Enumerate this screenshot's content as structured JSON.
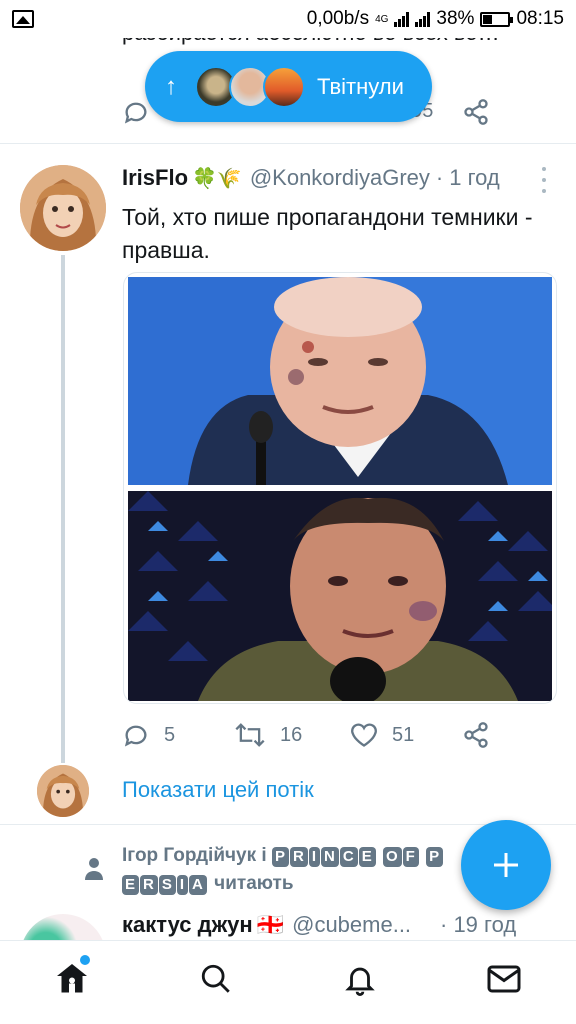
{
  "status_bar": {
    "network_speed": "0,00b/s",
    "network_type": "4G",
    "battery": "38%",
    "time": "08:15"
  },
  "prev_tweet": {
    "text": "разбирается абсолютно во всех во…",
    "share_count": "995"
  },
  "new_tweets_pill": {
    "label": "Твітнули"
  },
  "tweet": {
    "author_name": "IrisFlo",
    "author_emoji": "🍀🌾",
    "handle": "@KonkordiyaGrey",
    "separator": "·",
    "time": "1 год",
    "text": "Той, хто пише пропагандони темники - правша.",
    "replies": "5",
    "retweets": "16",
    "likes": "51"
  },
  "thread": {
    "show_thread_label": "Показати цей потік"
  },
  "following": {
    "name1": "Ігор Гордійчук і",
    "name2_top": [
      "P",
      "R",
      "I",
      "N",
      "C",
      "E"
    ],
    "name2_of": [
      "O",
      "F"
    ],
    "name2_bottom": [
      "P",
      "E",
      "R",
      "S",
      "I",
      "A"
    ],
    "suffix": "читають"
  },
  "next_tweet": {
    "author_name": "кактус джун",
    "author_emoji": "🇬🇪",
    "handle": "@cubeme...",
    "time": "· 19 год"
  },
  "colors": {
    "accent": "#1da1f2",
    "link": "#1b95e0",
    "muted": "#657786",
    "divider": "#e6ecf0"
  },
  "icons": {
    "status_left": "image-icon",
    "pill_arrow": "arrow-up-icon",
    "reply": "reply-icon",
    "retweet": "retweet-icon",
    "like": "heart-icon",
    "share": "share-icon",
    "menu": "more-vertical-icon",
    "compose": "plus-icon",
    "nav": [
      "home-icon",
      "search-icon",
      "bell-icon",
      "mail-icon"
    ]
  }
}
